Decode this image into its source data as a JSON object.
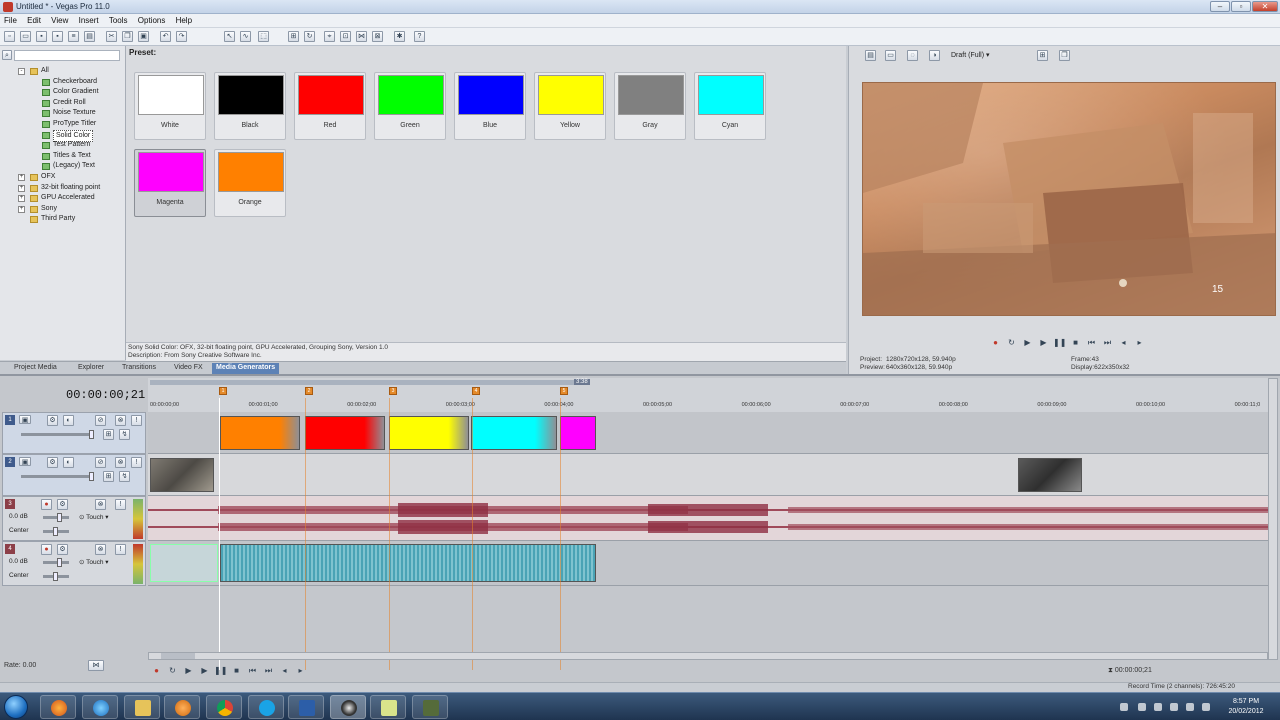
{
  "window": {
    "title": "Untitled * - Vegas Pro 11.0"
  },
  "menu": [
    "File",
    "Edit",
    "View",
    "Insert",
    "Tools",
    "Options",
    "Help"
  ],
  "explorer": {
    "tree": [
      {
        "label": "All",
        "level": 0,
        "type": "folder",
        "expander": "-"
      },
      {
        "label": "Checkerboard",
        "level": 2,
        "type": "item"
      },
      {
        "label": "Color Gradient",
        "level": 2,
        "type": "item"
      },
      {
        "label": "Credit Roll",
        "level": 2,
        "type": "item"
      },
      {
        "label": "Noise Texture",
        "level": 2,
        "type": "item"
      },
      {
        "label": "ProType Titler",
        "level": 2,
        "type": "item"
      },
      {
        "label": "Solid Color",
        "level": 2,
        "type": "item",
        "selected": true
      },
      {
        "label": "Test Pattern",
        "level": 2,
        "type": "item"
      },
      {
        "label": "Titles & Text",
        "level": 2,
        "type": "item"
      },
      {
        "label": "(Legacy) Text",
        "level": 2,
        "type": "item"
      },
      {
        "label": "OFX",
        "level": 1,
        "type": "folder",
        "expander": "+"
      },
      {
        "label": "32-bit floating point",
        "level": 1,
        "type": "folder",
        "expander": "+"
      },
      {
        "label": "GPU Accelerated",
        "level": 1,
        "type": "folder",
        "expander": "+"
      },
      {
        "label": "Sony",
        "level": 1,
        "type": "folder",
        "expander": "+"
      },
      {
        "label": "Third Party",
        "level": 1,
        "type": "folder",
        "expander": ""
      }
    ]
  },
  "generators": {
    "preset_label": "Preset:",
    "presets": [
      {
        "name": "White",
        "color": "#ffffff"
      },
      {
        "name": "Black",
        "color": "#000000"
      },
      {
        "name": "Red",
        "color": "#ff0000"
      },
      {
        "name": "Green",
        "color": "#00ff00"
      },
      {
        "name": "Blue",
        "color": "#0000ff"
      },
      {
        "name": "Yellow",
        "color": "#ffff00"
      },
      {
        "name": "Gray",
        "color": "#808080"
      },
      {
        "name": "Cyan",
        "color": "#00ffff"
      },
      {
        "name": "Magenta",
        "color": "#ff00ff",
        "selected": true
      },
      {
        "name": "Orange",
        "color": "#ff8000"
      }
    ],
    "description_line1": "Sony Solid Color: OFX, 32-bit floating point, GPU Accelerated, Grouping Sony, Version 1.0",
    "description_line2": "Description: From Sony Creative Software Inc."
  },
  "tabs": [
    "Project Media",
    "Explorer",
    "Transitions",
    "Video FX",
    "Media Generators"
  ],
  "active_tab": "Media Generators",
  "preview": {
    "quality": "Draft (Full)",
    "hud_number": "15",
    "info": {
      "project_label": "Project:",
      "project_value": "1280x720x128, 59.940p",
      "preview_label": "Preview:",
      "preview_value": "640x360x128, 59.940p",
      "frame_label": "Frame:",
      "frame_value": "43",
      "display_label": "Display:",
      "display_value": "622x350x32"
    }
  },
  "timeline": {
    "timecode": "00:00:00;21",
    "ruler_labels": [
      "00:00:00;00",
      "00:00:01;00",
      "00:00:02;00",
      "00:00:03;00",
      "00:00:04;00",
      "00:00:05;00",
      "00:00:06;00",
      "00:00:07;00",
      "00:00:08;00",
      "00:00:09;00",
      "00:00:10;00",
      "00:00:11;0"
    ],
    "markers": [
      "1",
      "2",
      "3",
      "4",
      "5"
    ],
    "marker_tag": "3:38",
    "tracks": [
      {
        "num": "1",
        "kind": "video"
      },
      {
        "num": "2",
        "kind": "video"
      },
      {
        "num": "3",
        "kind": "audio",
        "level": "0.0 dB",
        "mode": "Touch",
        "pan": "Center"
      },
      {
        "num": "4",
        "kind": "audio",
        "level": "0.0 dB",
        "mode": "Touch",
        "pan": "Center"
      }
    ],
    "color_clips": [
      "#ff8000",
      "#ff0000",
      "#ffff00",
      "#00ffff",
      "#ff00ff"
    ],
    "rate": "Rate: 0.00",
    "end_timecode": "00:00:00;21"
  },
  "status": {
    "record_time": "Record Time (2 channels): 726:45:20"
  },
  "taskbar": {
    "time": "8:57 PM",
    "date": "20/02/2012"
  }
}
